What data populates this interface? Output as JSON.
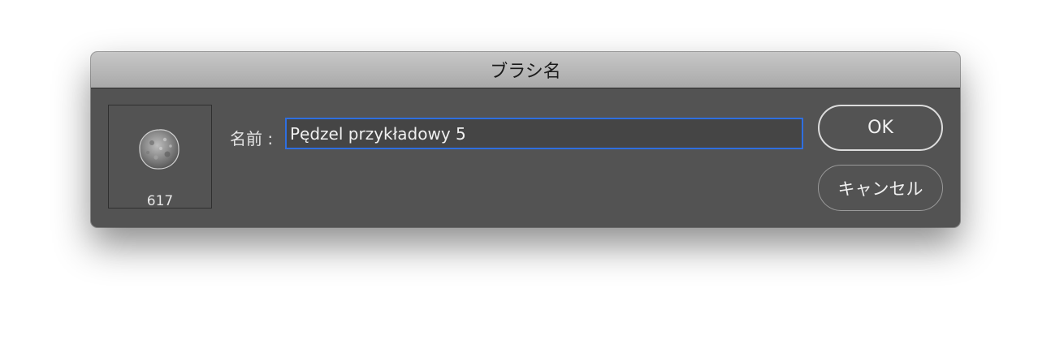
{
  "dialog": {
    "title": "ブラシ名",
    "preview": {
      "brush_size": "617",
      "icon": "brush-tip-icon"
    },
    "name_field": {
      "label": "名前 :",
      "value": "Pędzel przykładowy 5"
    },
    "buttons": {
      "ok_label": "OK",
      "cancel_label": "キャンセル"
    },
    "colors": {
      "dialog_bg": "#535353",
      "focus_ring": "#2f6fe0"
    }
  }
}
